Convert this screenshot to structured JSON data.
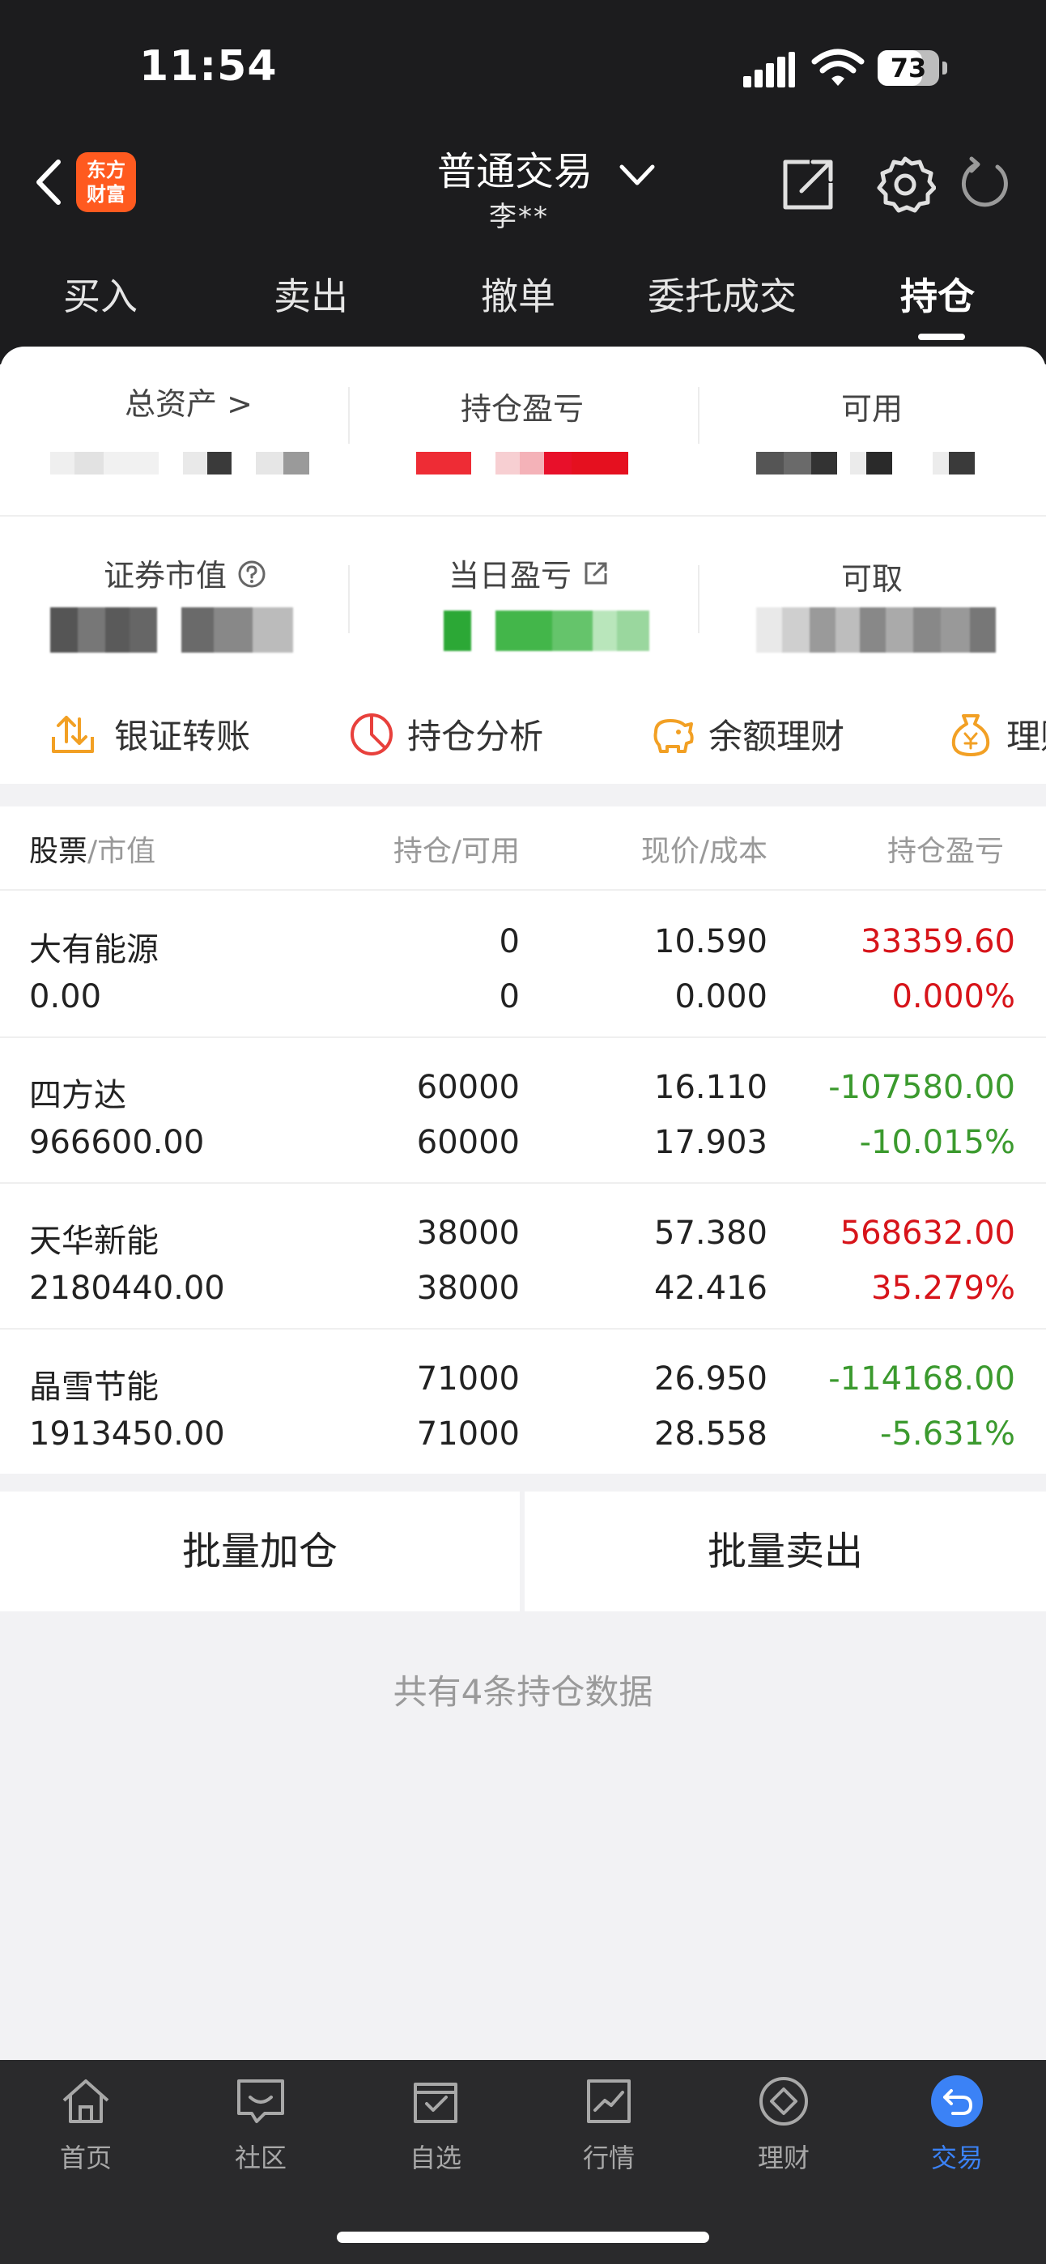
{
  "status": {
    "time": "11:54",
    "battery": "73",
    "battery_level": 0.73
  },
  "header": {
    "logo_line1": "东方",
    "logo_line2": "财富",
    "account_type": "普通交易",
    "account_user": "李**"
  },
  "tabs": [
    {
      "label": "买入"
    },
    {
      "label": "卖出"
    },
    {
      "label": "撤单"
    },
    {
      "label": "委托成交"
    },
    {
      "label": "持仓",
      "active": true
    }
  ],
  "summary": {
    "total_assets": "总资产 >",
    "position_pnl": "持仓盈亏",
    "available": "可用",
    "market_value": "证券市值",
    "daily_pnl": "当日盈亏",
    "withdrawable": "可取"
  },
  "quick_actions": [
    {
      "label": "银证转账",
      "icon": "transfer-icon"
    },
    {
      "label": "持仓分析",
      "icon": "pie-chart-icon"
    },
    {
      "label": "余额理财",
      "icon": "piggy-bank-icon"
    },
    {
      "label": "理财",
      "icon": "money-bag-icon"
    }
  ],
  "table": {
    "col1_a": "股票",
    "col1_b": "/市值",
    "col2": "持仓/可用",
    "col3": "现价/成本",
    "col4": "持仓盈亏",
    "rows": [
      {
        "name": "大有能源",
        "value": "0.00",
        "hold": "0",
        "avail": "0",
        "price": "10.590",
        "cost": "0.000",
        "pnl": "33359.60",
        "pnl_pct": "0.000%",
        "trend": "up"
      },
      {
        "name": "四方达",
        "value": "966600.00",
        "hold": "60000",
        "avail": "60000",
        "price": "16.110",
        "cost": "17.903",
        "pnl": "-107580.00",
        "pnl_pct": "-10.015%",
        "trend": "down"
      },
      {
        "name": "天华新能",
        "value": "2180440.00",
        "hold": "38000",
        "avail": "38000",
        "price": "57.380",
        "cost": "42.416",
        "pnl": "568632.00",
        "pnl_pct": "35.279%",
        "trend": "up"
      },
      {
        "name": "晶雪节能",
        "value": "1913450.00",
        "hold": "71000",
        "avail": "71000",
        "price": "26.950",
        "cost": "28.558",
        "pnl": "-114168.00",
        "pnl_pct": "-5.631%",
        "trend": "down"
      }
    ]
  },
  "actions": {
    "batch_buy": "批量加仓",
    "batch_sell": "批量卖出"
  },
  "footer": {
    "count_text": "共有4条持仓数据"
  },
  "bottom_nav": [
    {
      "label": "首页",
      "icon": "home-icon"
    },
    {
      "label": "社区",
      "icon": "chat-icon"
    },
    {
      "label": "自选",
      "icon": "watchlist-icon"
    },
    {
      "label": "行情",
      "icon": "market-chart-icon"
    },
    {
      "label": "理财",
      "icon": "diamond-icon"
    },
    {
      "label": "交易",
      "icon": "trade-icon",
      "active": true
    }
  ],
  "colors": {
    "up": "#d7141a",
    "down": "#3b9a2e",
    "accent": "#3b82f6",
    "brand": "#ff5a1f"
  }
}
